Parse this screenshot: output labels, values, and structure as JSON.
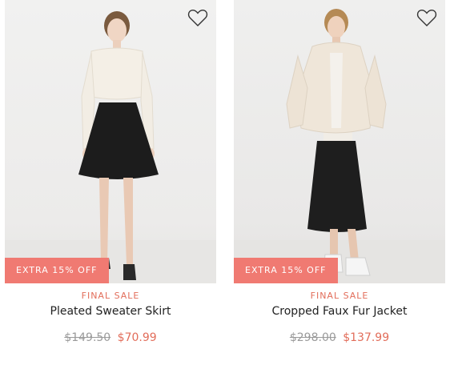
{
  "theme": {
    "accent": "#e26d5a",
    "badge": "#f07a72"
  },
  "products": [
    {
      "badge": "EXTRA 15% OFF",
      "tag": "FINAL SALE",
      "name": "Pleated Sweater Skirt",
      "original_price": "$149.50",
      "sale_price": "$70.99",
      "icon": "heart-outline-icon"
    },
    {
      "badge": "EXTRA 15% OFF",
      "tag": "FINAL SALE",
      "name": "Cropped Faux Fur Jacket",
      "original_price": "$298.00",
      "sale_price": "$137.99",
      "icon": "heart-outline-icon"
    }
  ]
}
